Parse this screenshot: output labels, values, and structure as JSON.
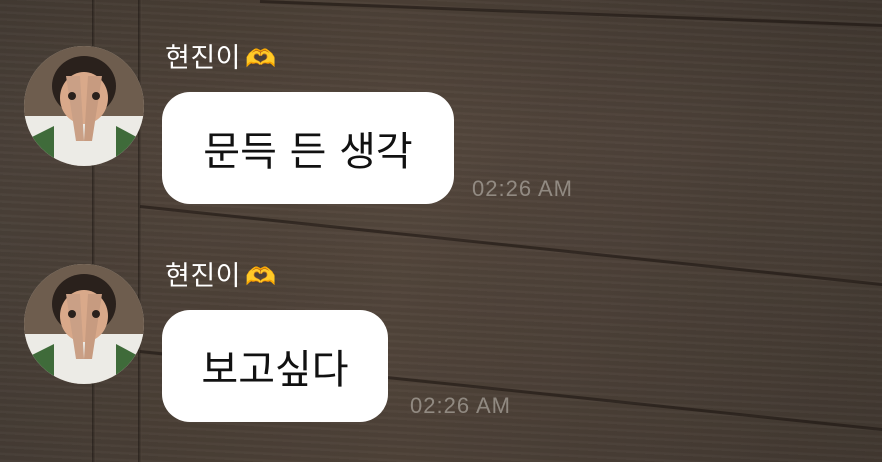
{
  "messages": [
    {
      "sender": "현진이",
      "sender_emoji": "🫶",
      "text": "문득 든 생각",
      "time": "02:26 AM"
    },
    {
      "sender": "현진이",
      "sender_emoji": "🫶",
      "text": "보고싶다",
      "time": "02:26 AM"
    }
  ],
  "colors": {
    "bubble": "#ffffff",
    "text": "#111111",
    "sender": "#ffffff",
    "timestamp": "#c8c4be",
    "background": "#4f4339"
  }
}
